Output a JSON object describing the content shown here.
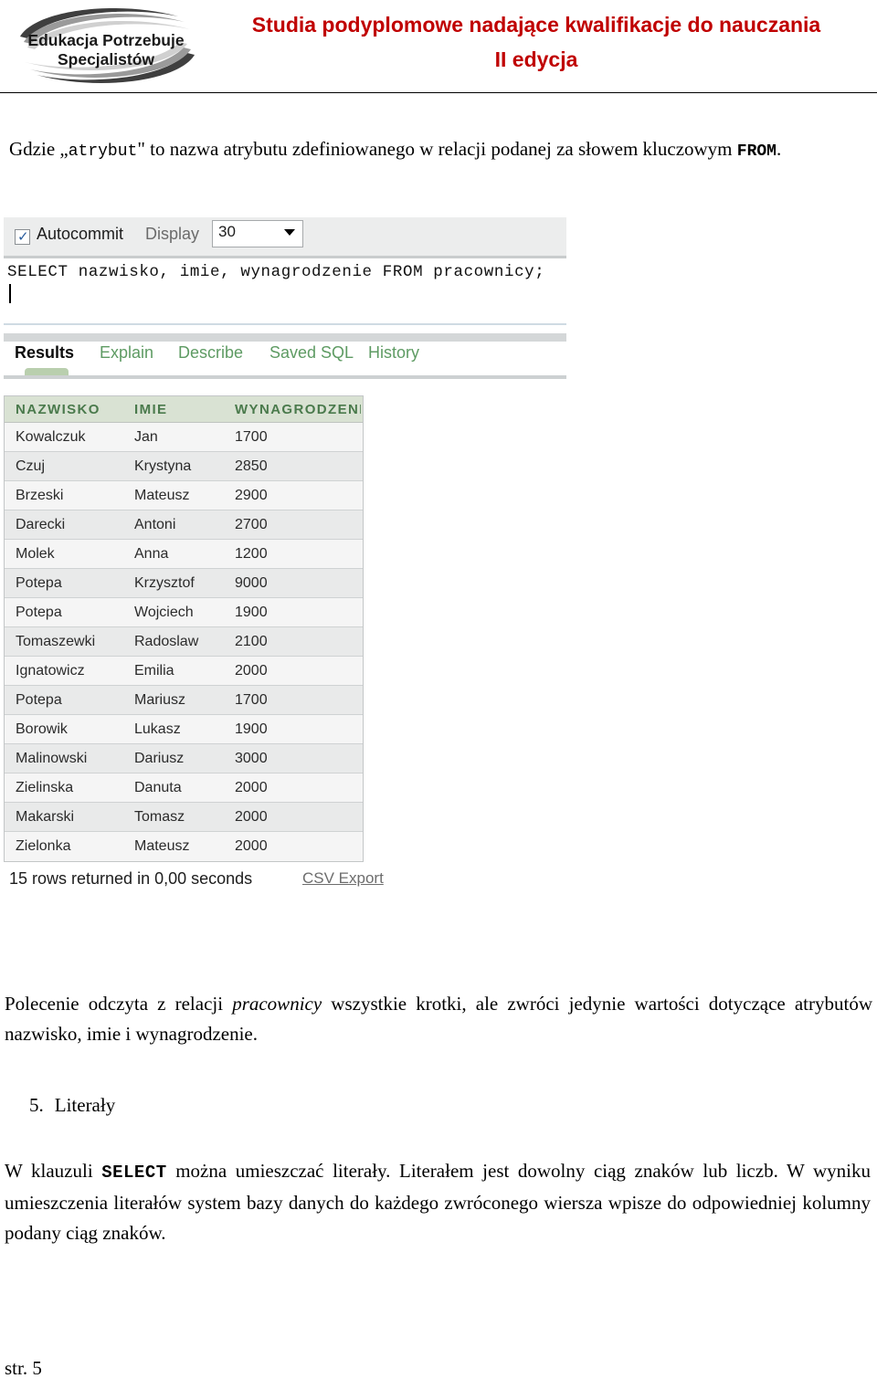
{
  "header": {
    "logo_line1": "Edukacja Potrzebuje",
    "logo_line2": "Specjalistów",
    "title_line1": "Studia podyplomowe nadające kwalifikacje do nauczania",
    "title_line2": "II edycja",
    "title_color": "#c00000"
  },
  "intro": {
    "before_code": "Gdzie „",
    "code": "atrybut",
    "after_code": "\" to nazwa atrybutu zdefiniowanego w relacji podanej za słowem kluczowym ",
    "keyword": "FROM",
    "tail": "."
  },
  "sql_tool": {
    "autocommit_label": "Autocommit",
    "autocommit_checked": "✓",
    "display_label": "Display",
    "display_value": "30",
    "caret_icon": "chevron-down-icon",
    "sql_query": "SELECT nazwisko, imie, wynagrodzenie FROM pracownicy;",
    "tabs": [
      {
        "label": "Results",
        "active": true
      },
      {
        "label": "Explain",
        "active": false
      },
      {
        "label": "Describe",
        "active": false
      },
      {
        "label": "Saved SQL",
        "active": false
      },
      {
        "label": "History",
        "active": false
      }
    ],
    "tab_active_color": "#0d0d0d",
    "tab_link_color": "#5e9b63"
  },
  "results": {
    "columns": [
      "NAZWISKO",
      "IMIE",
      "WYNAGRODZENIE"
    ],
    "rows": [
      [
        "Kowalczuk",
        "Jan",
        "1700"
      ],
      [
        "Czuj",
        "Krystyna",
        "2850"
      ],
      [
        "Brzeski",
        "Mateusz",
        "2900"
      ],
      [
        "Darecki",
        "Antoni",
        "2700"
      ],
      [
        "Molek",
        "Anna",
        "1200"
      ],
      [
        "Potepa",
        "Krzysztof",
        "9000"
      ],
      [
        "Potepa",
        "Wojciech",
        "1900"
      ],
      [
        "Tomaszewki",
        "Radoslaw",
        "2100"
      ],
      [
        "Ignatowicz",
        "Emilia",
        "2000"
      ],
      [
        "Potepa",
        "Mariusz",
        "1700"
      ],
      [
        "Borowik",
        "Lukasz",
        "1900"
      ],
      [
        "Malinowski",
        "Dariusz",
        "3000"
      ],
      [
        "Zielinska",
        "Danuta",
        "2000"
      ],
      [
        "Makarski",
        "Tomasz",
        "2000"
      ],
      [
        "Zielonka",
        "Mateusz",
        "2000"
      ]
    ],
    "rows_returned_text": "15 rows returned in 0,00 seconds",
    "csv_export_label": "CSV Export",
    "header_bg": "#d9e2d3",
    "header_text_color": "#4a7a4c"
  },
  "explain_paragraph": {
    "part1": "Polecenie odczyta z relacji ",
    "emphasis": "pracownicy",
    "part2": " wszystkie krotki, ale zwróci jedynie wartości dotyczące atrybutów nazwisko, imie i wynagrodzenie."
  },
  "section": {
    "number": "5.",
    "title": "Literały"
  },
  "literal_paragraph": {
    "part1": "W klauzuli ",
    "keyword": "SELECT",
    "part2": " można umieszczać literały. Literałem jest dowolny ciąg znaków lub liczb. W wyniku umieszczenia literałów system bazy danych do każdego zwróconego wiersza wpisze do odpowiedniej kolumny podany ciąg znaków."
  },
  "footer": {
    "page_label": "str. 5"
  }
}
